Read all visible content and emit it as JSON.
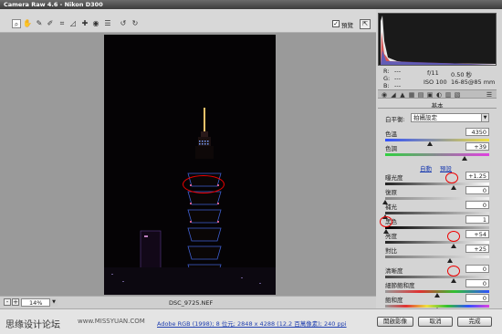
{
  "window": {
    "title": "Camera Raw 4.6  -  Nikon D300"
  },
  "toolbar": {
    "tools": [
      "zoom-icon",
      "hand-icon",
      "white-balance-icon",
      "color-sampler-icon",
      "crop-icon",
      "straighten-icon",
      "retouch-icon",
      "red-eye-icon",
      "preferences-icon",
      "rotate-left-icon",
      "rotate-right-icon"
    ],
    "preview_checked": "✓",
    "preview_label": "預覽"
  },
  "histogram": {
    "background": "#1a1a1a"
  },
  "readout": {
    "r": "R:",
    "r_val": "---",
    "g": "G:",
    "g_val": "---",
    "b": "B:",
    "b_val": "---",
    "aperture": "f/11",
    "shutter": "0.50 秒",
    "iso": "ISO 100",
    "lens": "16-85@85 mm"
  },
  "panel": {
    "title": "基本",
    "white_balance_label": "白平衡:",
    "white_balance_value": "拍攝設定",
    "temperature_label": "色溫",
    "temperature_value": "4350",
    "tint_label": "色調",
    "tint_value": "+39",
    "auto_link": "自動",
    "default_link": "預設",
    "exposure_label": "曝光度",
    "exposure_value": "+1.25",
    "recovery_label": "復原",
    "recovery_value": "0",
    "fill_label": "補光",
    "fill_value": "0",
    "blacks_label": "黑色",
    "blacks_value": "1",
    "brightness_label": "亮度",
    "brightness_value": "+54",
    "contrast_label": "對比",
    "contrast_value": "+25",
    "clarity_label": "清晰度",
    "clarity_value": "0",
    "vibrance_label": "細節飽和度",
    "vibrance_value": "0",
    "saturation_label": "飽和度",
    "saturation_value": "0",
    "slider_levels": {
      "temperature": 0.43,
      "tint": 0.76,
      "exposure": 0.66,
      "recovery": 0.0,
      "fill": 0.0,
      "blacks": 0.01,
      "brightness": 0.66,
      "contrast": 0.62,
      "clarity": 0.66,
      "vibrance": 0.5,
      "saturation": 0.5
    }
  },
  "zoom": {
    "minus": "-",
    "plus": "+",
    "value": "14%"
  },
  "image": {
    "filename": "DSC_9725.NEF"
  },
  "bottom": {
    "watermark": "思缘设计论坛",
    "watermark_url": "www.MISSYUAN.COM",
    "info": "Adobe RGB (1998); 8 位元; 2848 x 4288 (12.2 百萬像素); 240 ppi",
    "open_button": "開啟影像",
    "cancel_button": "取消",
    "done_button": "完成"
  }
}
